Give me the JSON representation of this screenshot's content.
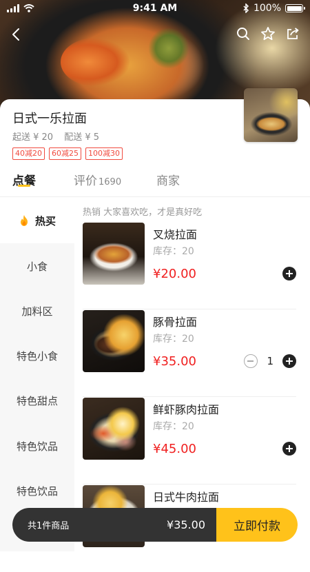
{
  "status_bar": {
    "time": "9:41 AM",
    "battery": "100%",
    "battery_level": 1.0
  },
  "header": {
    "back_icon": "chevron-left-icon",
    "actions": [
      "search-icon",
      "star-icon",
      "share-icon"
    ]
  },
  "shop": {
    "name": "日式一乐拉面",
    "min_order": "起送 ¥ 20",
    "delivery_fee": "配送 ¥ 5",
    "promos": [
      "40减20",
      "60减25",
      "100减30"
    ]
  },
  "tabs": [
    {
      "label": "点餐",
      "count": ""
    },
    {
      "label": "评价",
      "count": "1690"
    },
    {
      "label": "商家",
      "count": ""
    }
  ],
  "sidebar": {
    "items": [
      "热买",
      "小食",
      "加料区",
      "特色小食",
      "特色甜点",
      "特色饮品",
      "特色饮品"
    ]
  },
  "list": {
    "header": "热销 大家喜欢吃，才是真好吃",
    "items": [
      {
        "name": "叉烧拉面",
        "stock": "库存：20",
        "price": "¥20.00",
        "qty": ""
      },
      {
        "name": "豚骨拉面",
        "stock": "库存：20",
        "price": "¥35.00",
        "qty": "1"
      },
      {
        "name": "鲜虾豚肉拉面",
        "stock": "库存：20",
        "price": "¥45.00",
        "qty": ""
      },
      {
        "name": "日式牛肉拉面",
        "stock": "",
        "price": "",
        "qty": ""
      }
    ]
  },
  "cart": {
    "summary": "共1件商品",
    "total": "¥35.00",
    "pay_label": "立即付款"
  },
  "colors": {
    "accent": "#ffc21a",
    "price": "#f02020",
    "promo": "#f04a3e"
  }
}
